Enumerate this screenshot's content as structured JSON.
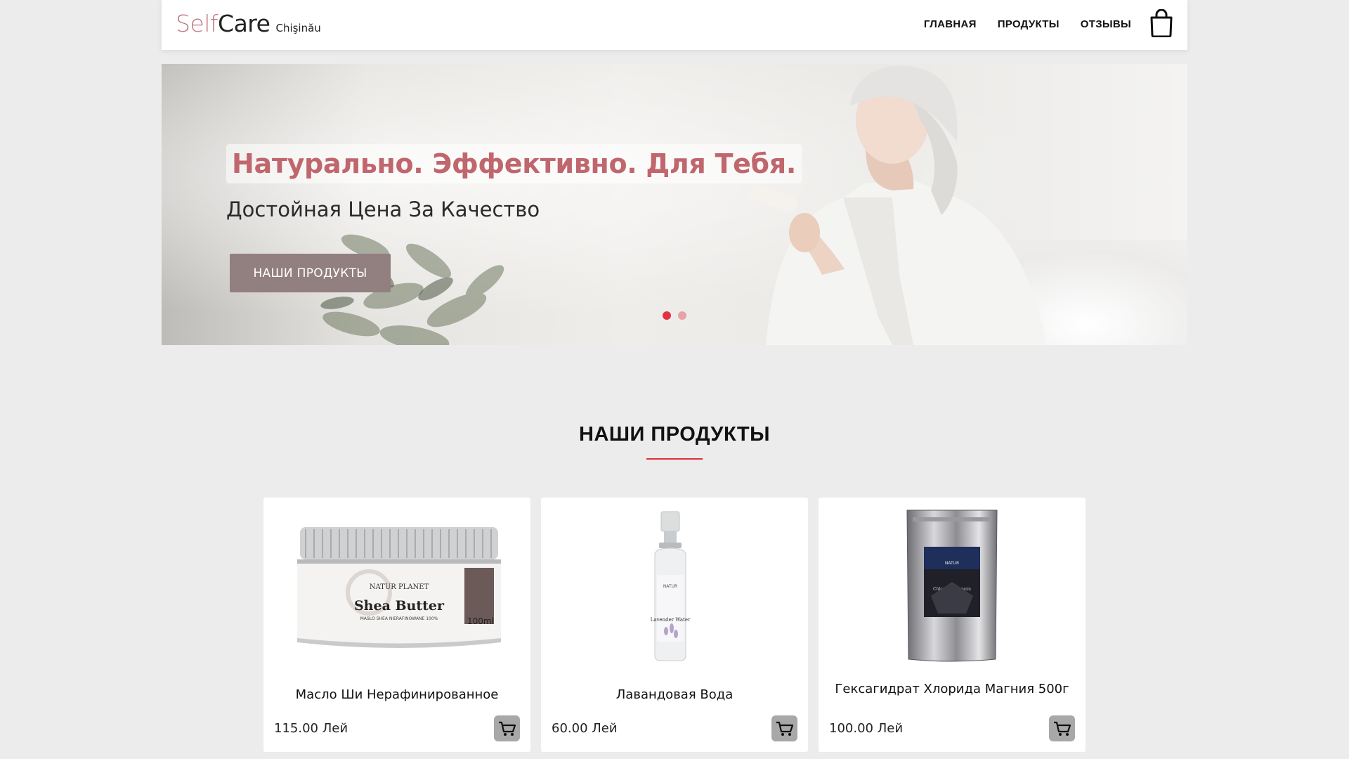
{
  "header": {
    "brand_self": "Self",
    "brand_care": "Care",
    "brand_city": "Chişinău",
    "nav": [
      "ГЛАВНАЯ",
      "ПРОДУКТЫ",
      "ОТЗЫВЫ"
    ]
  },
  "hero": {
    "title": "Натурально. Эффективно. Для Тебя.",
    "subtitle": "Достойная Цена За Качество",
    "button": "НАШИ ПРОДУКТЫ",
    "slides_total": 2,
    "active_slide": 1
  },
  "products": {
    "title": "НАШИ ПРОДУКТЫ",
    "items": [
      {
        "name": "Масло Ши Нерафинированное",
        "price": "115.00 Лей",
        "image": "shea-butter-jar",
        "jar_brand": "NATUR PLANET",
        "jar_label": "Shea Butter",
        "jar_sub": "MASŁO SHEA NIERAFINOWANE 100%",
        "jar_volume": "100ml"
      },
      {
        "name": "Лавандовая Вода",
        "price": "60.00 Лей",
        "image": "lavender-water-spray",
        "bottle_label": "Lavender Water"
      },
      {
        "name": "Гексагидрат Хлорида Магния 500г",
        "price": "100.00 Лей",
        "image": "magnesium-pouch",
        "pouch_label": "Chlorek Magnezu"
      }
    ]
  },
  "colors": {
    "accent": "#c0666d",
    "button": "#927f7f",
    "underline": "#e0303c",
    "dot_active": "#e5313f",
    "dot_idle": "#e7a2a6"
  }
}
